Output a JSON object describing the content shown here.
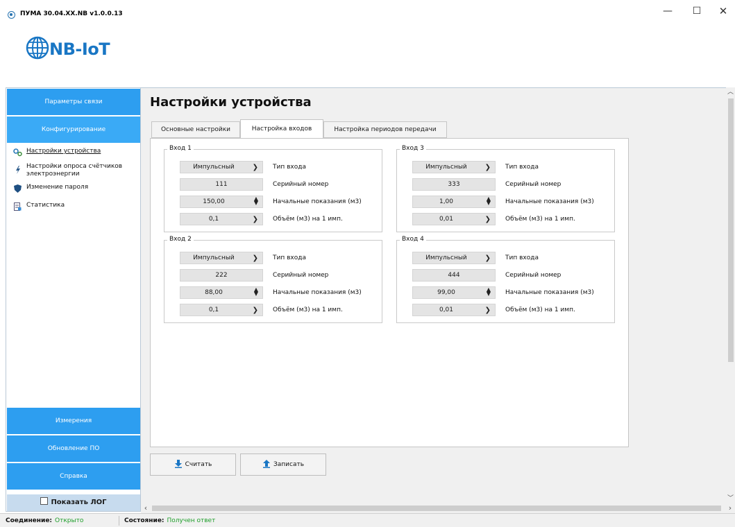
{
  "window": {
    "title": "ПУМА 30.04.XX.NB v1.0.0.13",
    "minimize": "—",
    "maximize": "☐",
    "close": "✕"
  },
  "logo": {
    "text": "NB-IoT",
    "icon": "globe-icon"
  },
  "sidebar": {
    "nav_top": [
      {
        "label": "Параметры связи"
      },
      {
        "label": "Конфигурирование"
      }
    ],
    "menu": [
      {
        "label": "Настройки устройства",
        "icon": "gears-icon"
      },
      {
        "label": "Настройки опроса счётчиков электроэнергии",
        "icon": "lightning-icon"
      },
      {
        "label": "Изменение пароля",
        "icon": "shield-icon"
      },
      {
        "label": "Статистика",
        "icon": "report-icon"
      }
    ],
    "nav_bottom": [
      {
        "label": "Измерения"
      },
      {
        "label": "Обновление ПО"
      },
      {
        "label": "Справка"
      }
    ],
    "show_log": "Показать ЛОГ"
  },
  "main": {
    "title": "Настройки устройства",
    "tabs": [
      {
        "label": "Основные настройки"
      },
      {
        "label": "Настройка входов"
      },
      {
        "label": "Настройка периодов передачи"
      }
    ],
    "field_labels": {
      "type": "Тип входа",
      "serial": "Серийный номер",
      "initial": "Начальные показания (м3)",
      "volume": "Объём (м3) на 1 имп."
    },
    "inputs": [
      {
        "title": "Вход 1",
        "type": "Импульсный",
        "serial": "111",
        "initial": "150,00",
        "volume": "0,1"
      },
      {
        "title": "Вход 2",
        "type": "Импульсный",
        "serial": "222",
        "initial": "88,00",
        "volume": "0,1"
      },
      {
        "title": "Вход 3",
        "type": "Импульсный",
        "serial": "333",
        "initial": "1,00",
        "volume": "0,01"
      },
      {
        "title": "Вход 4",
        "type": "Импульсный",
        "serial": "444",
        "initial": "99,00",
        "volume": "0,01"
      }
    ],
    "buttons": {
      "read": "Считать",
      "write": "Записать"
    }
  },
  "status": {
    "connection_label": "Соединение:",
    "connection_value": "Открыто",
    "state_label": "Состояние:",
    "state_value": "Получен ответ"
  },
  "colors": {
    "nav_blue": "#2d9ef0",
    "logo_blue": "#1976c4",
    "status_green": "#1e9e2a"
  }
}
